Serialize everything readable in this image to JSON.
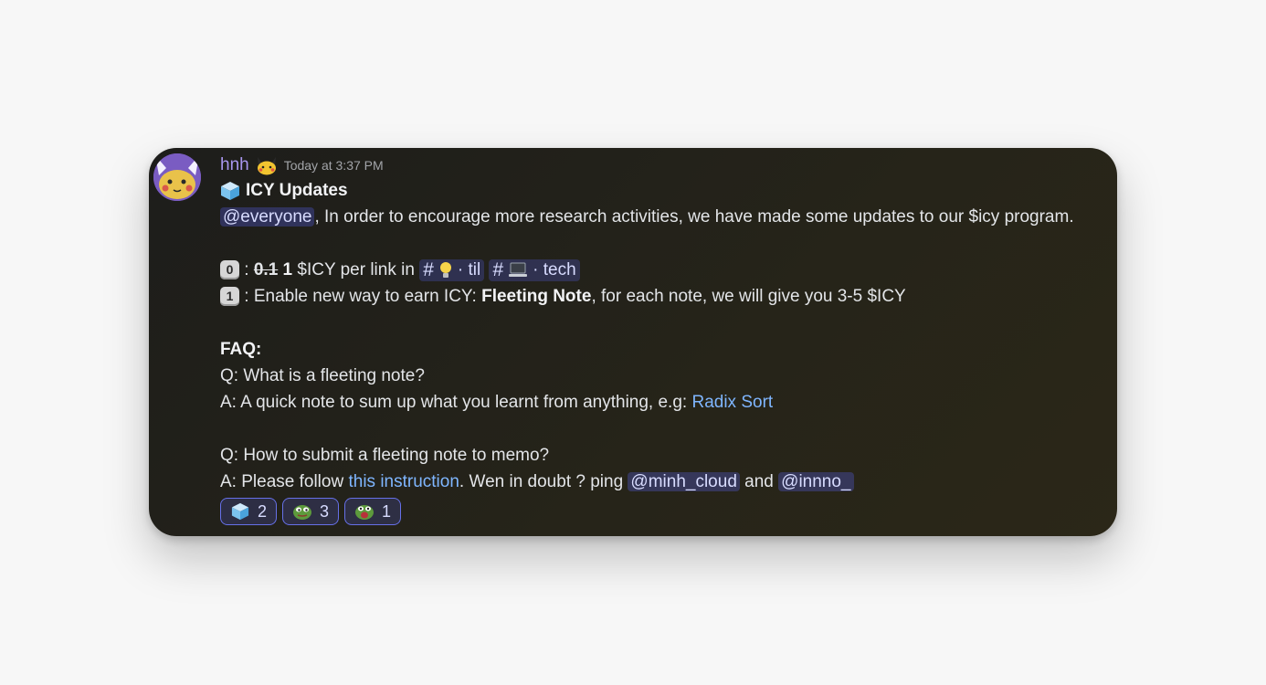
{
  "message": {
    "username": "hnh",
    "timestamp": "Today at 3:37 PM",
    "title": "ICY Updates",
    "mention_everyone": "@everyone",
    "intro": ", In order to encourage more research activities, we have made some updates to our $icy program.",
    "item0": {
      "keycap": "0",
      "sep": " : ",
      "old_value": "0.1",
      "new_value": "1",
      "text": " $ICY per link in ",
      "channel1": "· til",
      "channel2": "· tech"
    },
    "item1": {
      "keycap": "1",
      "text_a": " : Enable new way to earn ICY: ",
      "bold": "Fleeting Note",
      "text_b": ", for each note, we will give you 3-5 $ICY"
    },
    "faq_title": "FAQ:",
    "q1": "Q: What is a fleeting note?",
    "a1_text": "A: A quick note to sum up what you learnt from anything, e.g: ",
    "a1_link": "Radix Sort",
    "q2": "Q: How to submit a fleeting note to memo?",
    "a2_text": "A: Please follow ",
    "a2_link": "this instruction",
    "a2_text2": ". Wen in doubt ? ping ",
    "mention1": "@minh_cloud",
    "and": " and ",
    "mention2": "@innno_"
  },
  "reactions": [
    {
      "icon": "ice-cube-icon",
      "count": "2"
    },
    {
      "icon": "pepe-frog-icon",
      "count": "3"
    },
    {
      "icon": "pepe-shout-icon",
      "count": "1"
    }
  ],
  "colors": {
    "username": "#a896ee",
    "link": "#7fb6ff",
    "mention_bg": "#5865f2"
  }
}
